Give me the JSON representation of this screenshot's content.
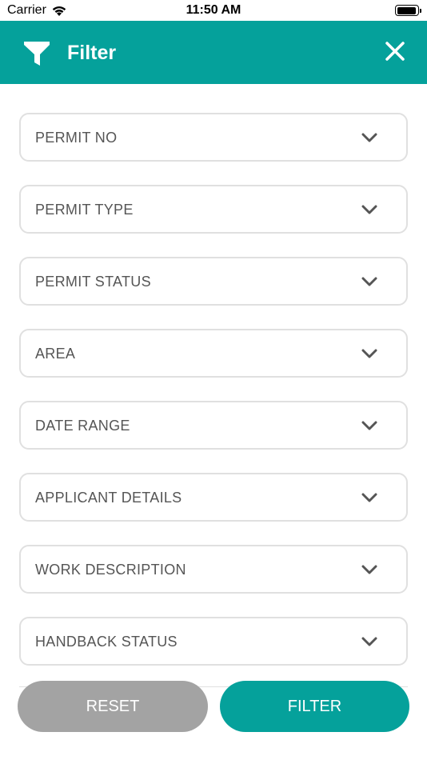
{
  "status_bar": {
    "carrier": "Carrier",
    "time": "11:50 AM"
  },
  "header": {
    "title": "Filter",
    "filter_icon": "filter-funnel-icon",
    "close_icon": "close-icon"
  },
  "filters": [
    {
      "label": "PERMIT NO"
    },
    {
      "label": "PERMIT TYPE"
    },
    {
      "label": "PERMIT STATUS"
    },
    {
      "label": "AREA"
    },
    {
      "label": "DATE RANGE"
    },
    {
      "label": "APPLICANT DETAILS"
    },
    {
      "label": "WORK DESCRIPTION"
    },
    {
      "label": "HANDBACK STATUS"
    }
  ],
  "actions": {
    "reset_label": "RESET",
    "filter_label": "FILTER"
  },
  "colors": {
    "accent": "#05a19b",
    "reset_bg": "#a3a3a3",
    "field_border": "#e0e0e0",
    "label_text": "#555555"
  }
}
